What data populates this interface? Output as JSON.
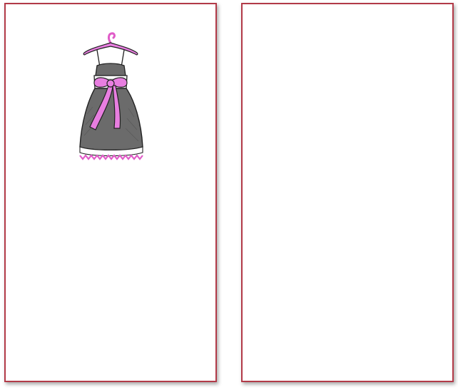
{
  "cards": [
    {
      "id": "left",
      "illustration": "dress-on-hanger"
    },
    {
      "id": "right",
      "illustration": ""
    }
  ],
  "colors": {
    "border": "#b23a48",
    "dress_body": "#6b6b6b",
    "dress_band": "#ffffff",
    "ribbon": "#e87ee0",
    "hanger": "#e05cc8",
    "hem_trim": "#e05cc8"
  }
}
